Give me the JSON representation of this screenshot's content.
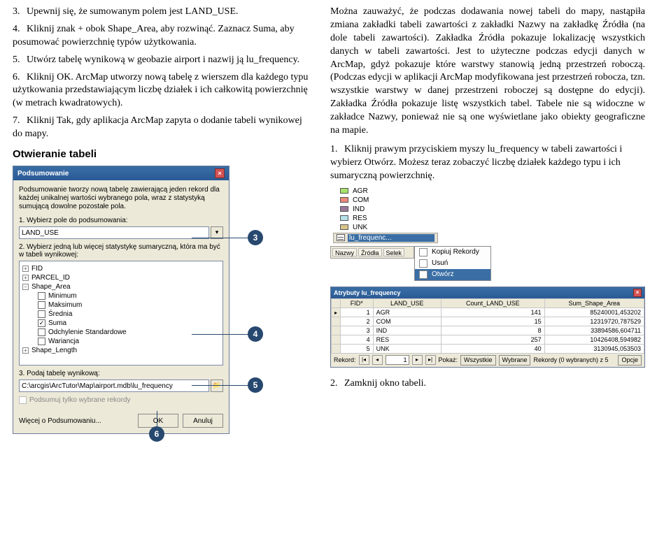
{
  "left": {
    "steps": [
      {
        "n": "3.",
        "t": "Upewnij się, że sumowanym polem jest LAND_USE."
      },
      {
        "n": "4.",
        "t": "Kliknij znak + obok Shape_Area, aby rozwinąć. Zaznacz Suma, aby posumować powierzchnię typów użytkowania."
      },
      {
        "n": "5.",
        "t": "Utwórz tabelę wynikową w geobazie airport i nazwij ją lu_frequency."
      },
      {
        "n": "6.",
        "t": "Kliknij OK. ArcMap utworzy nową tabelę z wierszem dla każdego typu użytkowania przedstawiającym liczbę działek i ich całkowitą powierzchnię (w metrach kwadratowych)."
      },
      {
        "n": "7.",
        "t": "Kliknij Tak, gdy aplikacja ArcMap zapyta o dodanie tabeli wynikowej do mapy."
      }
    ],
    "sectionTitle": "Otwieranie tabeli",
    "dlg": {
      "title": "Podsumowanie",
      "desc": "Podsumowanie tworzy nową tabelę zawierającą jeden rekord dla każdej unikalnej wartości wybranego pola, wraz z statystyką sumującą dowolne pozostałe pola.",
      "l1": "1. Wybierz pole do podsumowania:",
      "f1": "LAND_USE",
      "l2": "2. Wybierz jedną lub więcej statystykę sumaryczną, która ma być w tabeli wynikowej:",
      "tree": {
        "fid": "FID",
        "parcel": "PARCEL_ID",
        "shape": "Shape_Area",
        "min": "Minimum",
        "max": "Maksimum",
        "avg": "Średnia",
        "sum": "Suma",
        "std": "Odchylenie Standardowe",
        "var": "Wariancja",
        "len": "Shape_Length"
      },
      "l3": "3. Podaj tabelę wynikową:",
      "f3": "C:\\arcgis\\ArcTutor\\Map\\airport.mdb\\lu_frequency",
      "onlysel": "Podsumuj tylko wybrane rekordy",
      "about": "Więcej o Podsumowaniu...",
      "ok": "OK",
      "cancel": "Anuluj"
    },
    "callouts": {
      "c3": "3",
      "c4": "4",
      "c5": "5",
      "c6": "6"
    }
  },
  "right": {
    "intro": "Można zauważyć, że podczas dodawania nowej tabeli do mapy, nastąpiła zmiana zakładki tabeli zawartości z zakładki Nazwy na zakładkę Źródła (na dole tabeli zawartości). Zakładka Źródła pokazuje lokalizację wszystkich danych w tabeli zawartości. Jest to użyteczne podczas edycji danych w ArcMap, gdyż pokazuje które warstwy stanowią jedną przestrzeń roboczą. (Podczas edycji w aplikacji ArcMap modyfikowana jest przestrzeń robocza, tzn. wszystkie warstwy w danej przestrzeni roboczej są dostępne do edycji). Zakładka Źródła pokazuje listę wszystkich tabel. Tabele nie są widoczne w zakładce Nazwy, ponieważ nie są one wyświetlane jako obiekty geograficzne na mapie.",
    "step1": {
      "n": "1.",
      "t": "Kliknij prawym przyciskiem myszy lu_frequency w tabeli zawartości i wybierz Otwórz. Możesz teraz zobaczyć liczbę działek każdego typu i ich sumaryczną powierzchnię."
    },
    "layers": {
      "agr": "AGR",
      "com": "COM",
      "ind": "IND",
      "res": "RES",
      "unk": "UNK"
    },
    "tocSel": "lu_frequenc...",
    "ctx": {
      "copy": "Kopiuj Rekordy",
      "remove": "Usuń",
      "open": "Otwórz"
    },
    "tabs": {
      "a": "Nazwy",
      "b": "Źródła",
      "c": "Selek"
    },
    "att": {
      "title": "Atrybuty lu_frequency",
      "cols": {
        "fid": "FID*",
        "lu": "LAND_USE",
        "cnt": "Count_LAND_USE",
        "sum": "Sum_Shape_Area"
      },
      "rows": [
        {
          "fid": "1",
          "lu": "AGR",
          "cnt": "141",
          "sum": "85240001,453202"
        },
        {
          "fid": "2",
          "lu": "COM",
          "cnt": "15",
          "sum": "12319720,787529"
        },
        {
          "fid": "3",
          "lu": "IND",
          "cnt": "8",
          "sum": "33894586,604711"
        },
        {
          "fid": "4",
          "lu": "RES",
          "cnt": "257",
          "sum": "10426408,594982"
        },
        {
          "fid": "5",
          "lu": "UNK",
          "cnt": "40",
          "sum": "3130945,053503"
        }
      ],
      "foot": {
        "rekord": "Rekord:",
        "cur": "1",
        "pokaz": "Pokaż:",
        "all": "Wszystkie",
        "sel": "Wybrane",
        "info": "Rekordy (0 wybranych) z 5",
        "opt": "Opcje"
      }
    },
    "step2": {
      "n": "2.",
      "t": "Zamknij okno tabeli."
    }
  }
}
